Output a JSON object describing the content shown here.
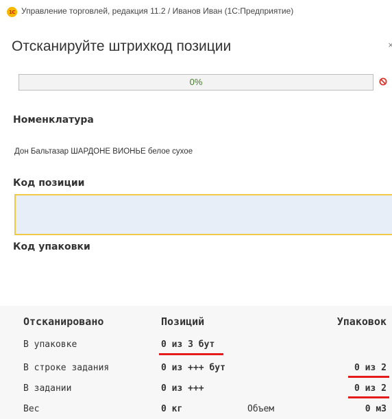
{
  "window": {
    "logo_text": "1С",
    "title": "Управление торговлей, редакция 11.2 / Иванов Иван  (1С:Предприятие)"
  },
  "form": {
    "title": "Отсканируйте штрихкод позиции"
  },
  "progress": {
    "text": "0%",
    "value": 0
  },
  "nomenclature": {
    "label": "Номенклатура",
    "value": "Дон Бальтазар ШАРДОНЕ ВИОНЬЕ белое сухое"
  },
  "position_code": {
    "label": "Код позиции",
    "value": ""
  },
  "package_code": {
    "label": "Код упаковки"
  },
  "stats": {
    "header": {
      "scanned": "Отсканировано",
      "positions": "Позиций",
      "packages": "Упаковок"
    },
    "rows": [
      {
        "label": "В упаковке",
        "positions": "0 из 3 бут",
        "packages": ""
      },
      {
        "label": "В строке задания",
        "positions": "0 из +++ бут",
        "packages": "0 из 2"
      },
      {
        "label": "В задании",
        "positions": "0 из +++",
        "packages": "0 из 2"
      },
      {
        "label": "Вес",
        "positions": "0 кг",
        "volume_label": "Объем",
        "packages": "0 м3"
      }
    ]
  },
  "colors": {
    "accent_yellow": "#f0c945",
    "progress_green": "#7bbf6a",
    "cancel_red": "#d9362b",
    "highlight_red": "#e51b1b"
  }
}
